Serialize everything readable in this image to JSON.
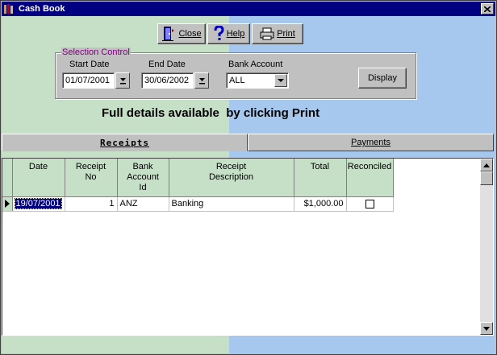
{
  "window": {
    "title": "Cash Book"
  },
  "toolbar": {
    "close_label": "Close",
    "help_label": "Help",
    "print_label": "Print"
  },
  "selection": {
    "group_title": "Selection Control",
    "start_date_label": "Start Date",
    "start_date_value": "01/07/2001",
    "end_date_label": "End Date",
    "end_date_value": "30/06/2002",
    "bank_account_label": "Bank Account",
    "bank_account_value": "ALL",
    "display_label": "Display"
  },
  "info_text": "Full details available  by clicking Print",
  "tabs": {
    "receipts": "Receipts",
    "payments": "Payments"
  },
  "grid": {
    "headers": {
      "date": "Date",
      "receipt_no_1": "Receipt",
      "receipt_no_2": "No",
      "bank_1": "Bank",
      "bank_2": "Account",
      "bank_3": "Id",
      "desc_1": "Receipt",
      "desc_2": "Description",
      "total": "Total",
      "reconciled": "Reconciled"
    },
    "rows": [
      {
        "date": "19/07/2001",
        "receipt_no": "1",
        "bank_account_id": "ANZ",
        "description": "Banking",
        "total": "$1,000.00",
        "reconciled": false
      }
    ]
  },
  "colors": {
    "title_bar": "#000080",
    "green_panel": "#c6e0c8",
    "blue_panel": "#a6c8ee",
    "group_title": "#800080"
  }
}
